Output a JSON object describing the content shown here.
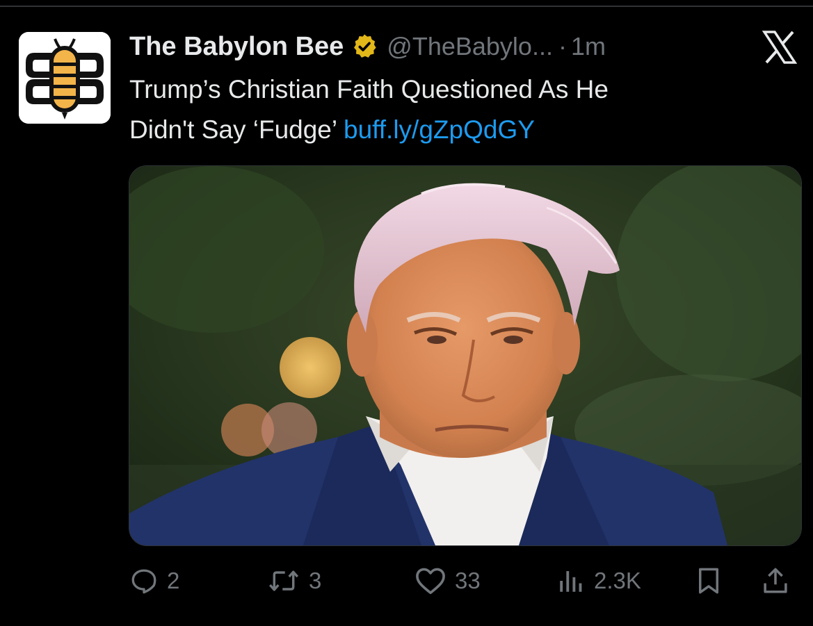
{
  "tweet": {
    "display_name": "The Babylon Bee",
    "handle": "@TheBabylo...",
    "separator": "·",
    "time": "1m",
    "text_line1": "Trump’s Christian Faith Questioned As He",
    "text_line2": "Didn't Say ‘Fudge’ ",
    "link": "buff.ly/gZpQdGY"
  },
  "actions": {
    "replies": "2",
    "retweets": "3",
    "likes": "33",
    "views": "2.3K"
  },
  "colors": {
    "background": "#000000",
    "text": "#e7e9ea",
    "muted": "#71767b",
    "link": "#1d9bf0",
    "verified_badge": "#e2b719",
    "bee_yellow": "#f3b44a"
  },
  "icons": {
    "avatar": "babylon-bee-logo",
    "verified": "verified-badge-icon",
    "platform": "x-logo-icon",
    "reply": "reply-icon",
    "retweet": "retweet-icon",
    "like": "heart-icon",
    "views": "views-icon",
    "bookmark": "bookmark-icon",
    "share": "share-icon"
  }
}
